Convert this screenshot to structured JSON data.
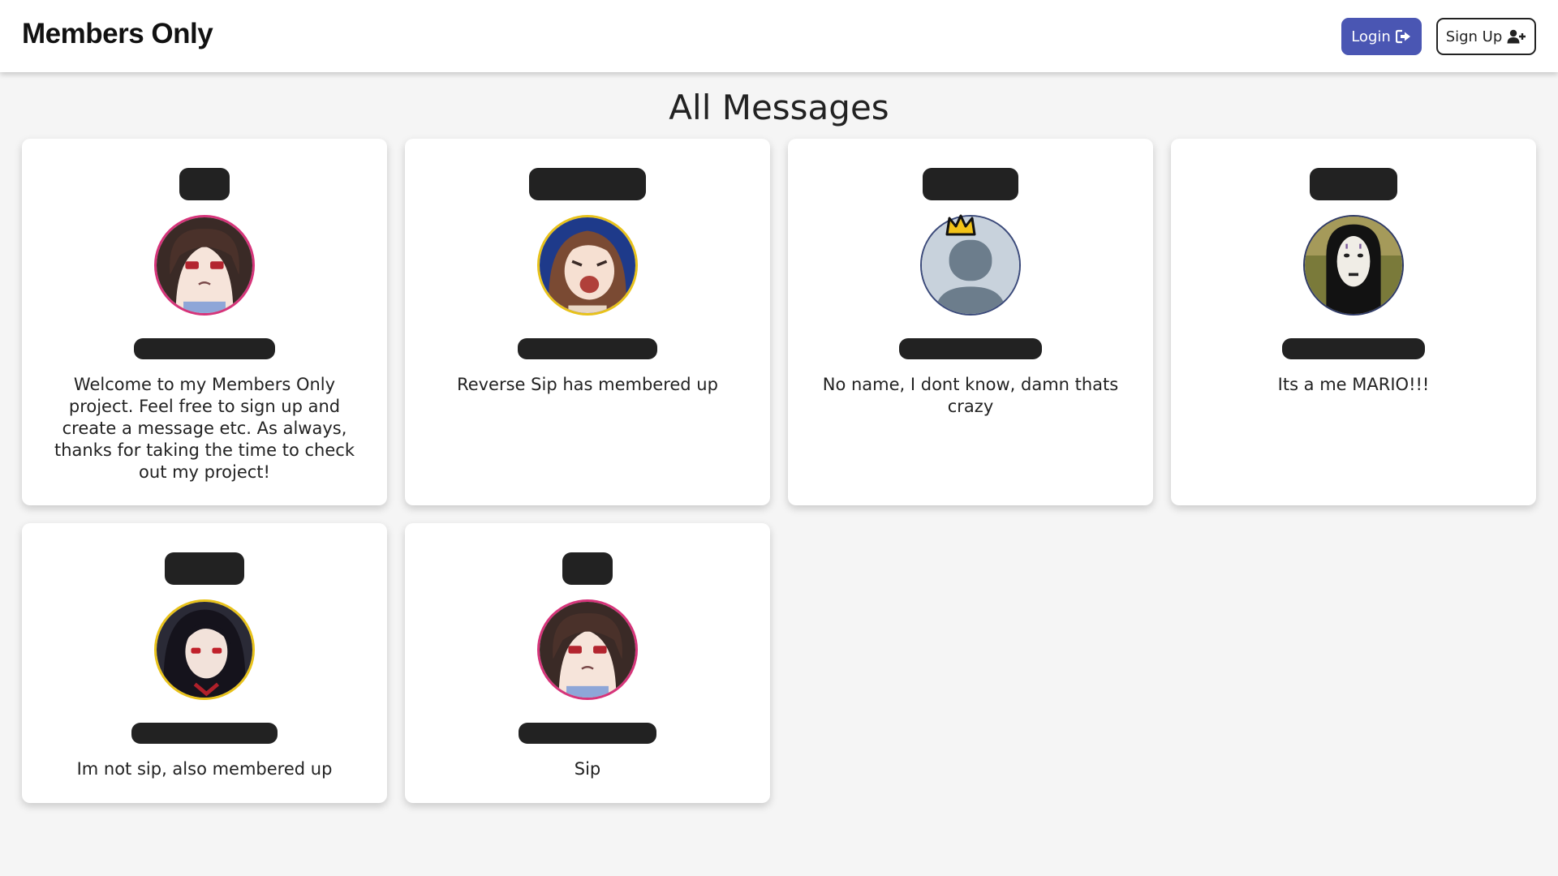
{
  "navbar": {
    "brand": "Members Only",
    "login_label": "Login",
    "signup_label": "Sign Up",
    "login_color": "#4a56b3"
  },
  "page": {
    "title": "All Messages"
  },
  "messages": [
    {
      "text": "Welcome to my Members Only project. Feel free to sign up and create a message etc. As always, thanks for taking the time to check out my project!",
      "avatar": "anime-girl-annoyed",
      "ring_color": "#d6347a"
    },
    {
      "text": "Reverse Sip has membered up",
      "avatar": "anime-girl-yelling",
      "ring_color": "#e8c21a"
    },
    {
      "text": "No name, I dont know, damn thats crazy",
      "avatar": "default-crown-silhouette",
      "ring_color": "#3b4a7a"
    },
    {
      "text": "Its a me MARIO!!!",
      "avatar": "no-face-mask",
      "ring_color": "#2f3a66"
    },
    {
      "text": "Im not sip, also membered up",
      "avatar": "anime-girl-dark-hair",
      "ring_color": "#e8c21a"
    },
    {
      "text": "Sip",
      "avatar": "anime-girl-annoyed",
      "ring_color": "#d6347a"
    }
  ]
}
